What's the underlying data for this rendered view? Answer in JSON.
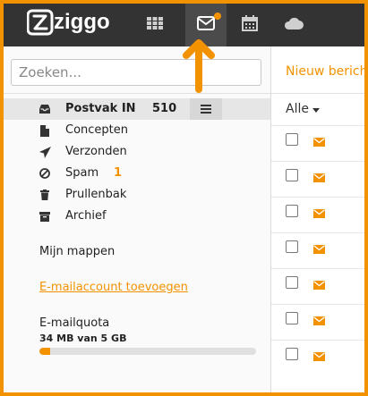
{
  "header": {
    "logo_text": "ziggo",
    "nav": [
      {
        "icon": "apps-grid-icon"
      },
      {
        "icon": "mail-icon",
        "active": true,
        "notification": true
      },
      {
        "icon": "calendar-icon"
      },
      {
        "icon": "cloud-icon"
      }
    ]
  },
  "search": {
    "placeholder": "Zoeken..."
  },
  "folders": [
    {
      "label": "Postvak IN",
      "count": "510",
      "icon": "inbox-icon",
      "selected": true
    },
    {
      "label": "Concepten",
      "icon": "draft-document-icon"
    },
    {
      "label": "Verzonden",
      "icon": "paper-plane-icon"
    },
    {
      "label": "Spam",
      "count": "1",
      "icon": "ban-icon"
    },
    {
      "label": "Prullenbak",
      "icon": "trash-icon"
    },
    {
      "label": "Archief",
      "icon": "archive-box-icon"
    }
  ],
  "my_folders_label": "Mijn mappen",
  "add_account_label": "E-mailaccount toevoegen",
  "quota": {
    "label": "E-mailquota",
    "value": "34 MB van 5 GB",
    "fraction": 0.05
  },
  "main": {
    "new_message_label": "Nieuw bericht",
    "filter_label": "Alle",
    "rows": 7
  },
  "colors": {
    "accent": "#f39200",
    "topbar": "#333333",
    "selected_row": "#e6e6e6"
  }
}
